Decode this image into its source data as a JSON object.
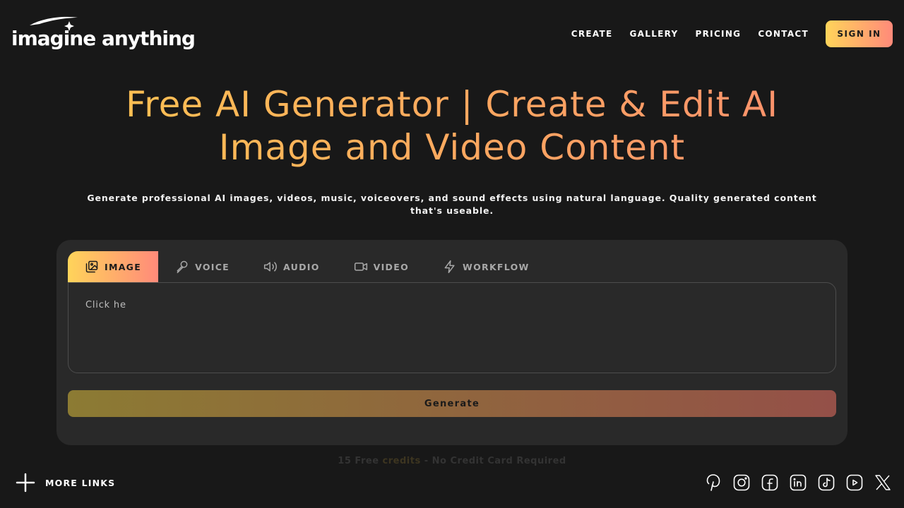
{
  "brand": {
    "logo_text": "imagine anything"
  },
  "nav": {
    "links": [
      "CREATE",
      "GALLERY",
      "PRICING",
      "CONTACT"
    ],
    "signin_label": "SIGN IN"
  },
  "hero": {
    "title": "Free AI Generator | Create & Edit AI Image and Video Content",
    "subtitle": "Generate professional AI images, videos, music, voiceovers, and sound effects using natural language. Quality generated content that's useable."
  },
  "creator": {
    "tabs": [
      {
        "label": "IMAGE",
        "icon": "image-icon",
        "active": true
      },
      {
        "label": "VOICE",
        "icon": "microphone-icon",
        "active": false
      },
      {
        "label": "AUDIO",
        "icon": "speaker-icon",
        "active": false
      },
      {
        "label": "VIDEO",
        "icon": "video-camera-icon",
        "active": false
      },
      {
        "label": "WORKFLOW",
        "icon": "lightning-icon",
        "active": false
      }
    ],
    "prompt_placeholder": "Click he",
    "generate_label": "Generate"
  },
  "credits": {
    "prefix": "15 Free ",
    "highlight": "credits",
    "suffix": " - No Credit Card Required"
  },
  "footer": {
    "more_links_label": "MORE LINKS",
    "socials": [
      "pinterest-icon",
      "instagram-icon",
      "facebook-icon",
      "linkedin-icon",
      "tiktok-icon",
      "youtube-icon",
      "x-icon"
    ]
  },
  "colors": {
    "background": "#181818",
    "card": "#292929",
    "accent_start": "#ffd45a",
    "accent_end": "#ff8a7a"
  }
}
